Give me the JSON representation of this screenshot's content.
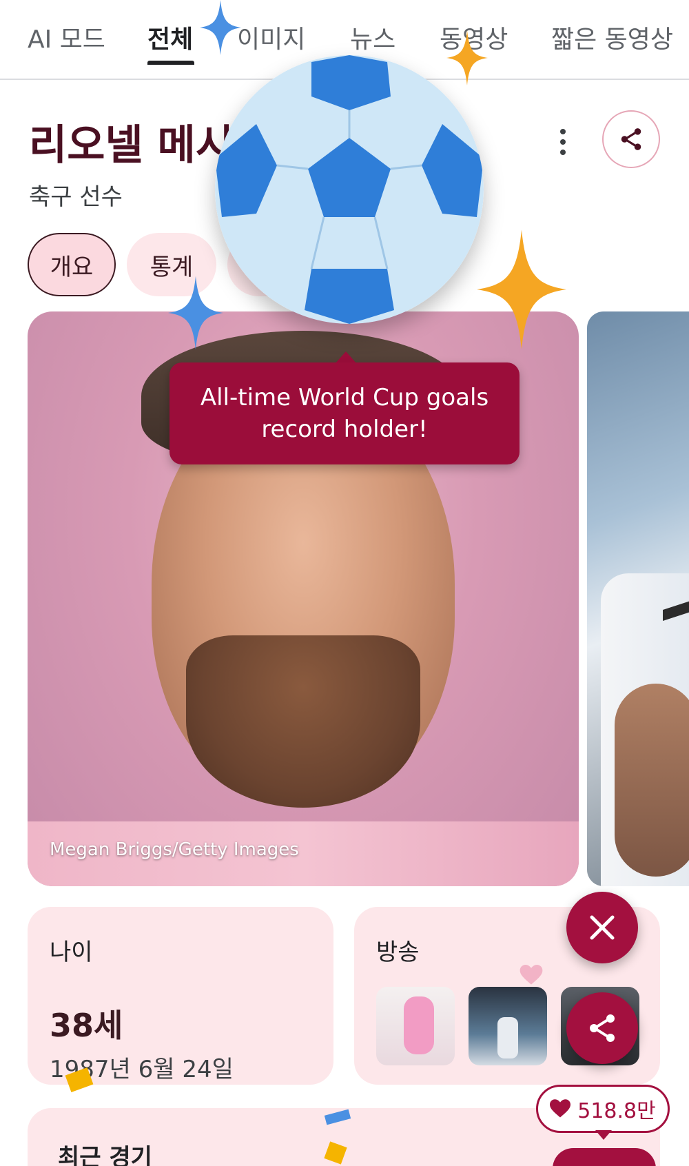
{
  "tabs": [
    {
      "label": "AI 모드",
      "active": false
    },
    {
      "label": "전체",
      "active": true
    },
    {
      "label": "이미지",
      "active": false
    },
    {
      "label": "뉴스",
      "active": false
    },
    {
      "label": "동영상",
      "active": false
    },
    {
      "label": "짧은 동영상",
      "active": false
    }
  ],
  "header": {
    "title": "리오넬 메시",
    "subtitle": "축구 선수"
  },
  "chips": [
    {
      "label": "개요",
      "active": true
    },
    {
      "label": "통계",
      "active": false
    }
  ],
  "hero": {
    "credit": "Megan Briggs/Getty Images"
  },
  "tooltip": {
    "text": "All-time World Cup goals record holder!"
  },
  "age_card": {
    "label": "나이",
    "value": "38세",
    "birthdate": "1987년 6월 24일"
  },
  "broadcast_card": {
    "label": "방송"
  },
  "recent_card": {
    "label": "최근 경기"
  },
  "likes": {
    "count": "518.8만"
  },
  "colors": {
    "accent": "#a3103f",
    "title": "#4a1022",
    "card_bg": "#fde7ea"
  },
  "icons": {
    "share": "share-icon",
    "more": "more-vert-icon",
    "close": "close-icon",
    "heart": "heart-icon",
    "soccer_ball": "soccer-ball-icon",
    "sparkle": "sparkle-icon"
  }
}
